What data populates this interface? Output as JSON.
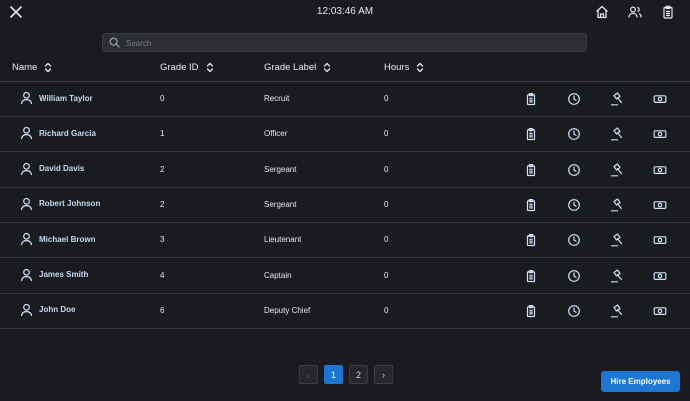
{
  "header": {
    "time": "12:03:46 AM",
    "icons": [
      "close-icon",
      "home-icon",
      "users-icon",
      "clipboard-icon"
    ]
  },
  "search": {
    "placeholder": "Search",
    "value": ""
  },
  "columns": [
    "Name",
    "Grade ID",
    "Grade Label",
    "Hours"
  ],
  "rows": [
    {
      "name": "William Taylor",
      "grade_id": "0",
      "grade_label": "Recruit",
      "hours": "0"
    },
    {
      "name": "Richard Garcia",
      "grade_id": "1",
      "grade_label": "Officer",
      "hours": "0"
    },
    {
      "name": "David Davis",
      "grade_id": "2",
      "grade_label": "Sergeant",
      "hours": "0"
    },
    {
      "name": "Robert Johnson",
      "grade_id": "2",
      "grade_label": "Sergeant",
      "hours": "0"
    },
    {
      "name": "Michael Brown",
      "grade_id": "3",
      "grade_label": "Lieutenant",
      "hours": "0"
    },
    {
      "name": "James Smith",
      "grade_id": "4",
      "grade_label": "Captain",
      "hours": "0"
    },
    {
      "name": "John Doe",
      "grade_id": "6",
      "grade_label": "Deputy Chief",
      "hours": "0"
    }
  ],
  "row_actions": [
    "clipboard-icon",
    "clock-icon",
    "gavel-icon",
    "cash-icon"
  ],
  "pagination": {
    "prev": "‹",
    "pages": [
      "1",
      "2"
    ],
    "current": "1",
    "next": "›"
  },
  "hire_button": "Hire Employees",
  "colors": {
    "accent": "#1c76d2",
    "background": "#1a1b1e",
    "name_text": "#c5dcf5",
    "icon": "#cfe2f6"
  }
}
